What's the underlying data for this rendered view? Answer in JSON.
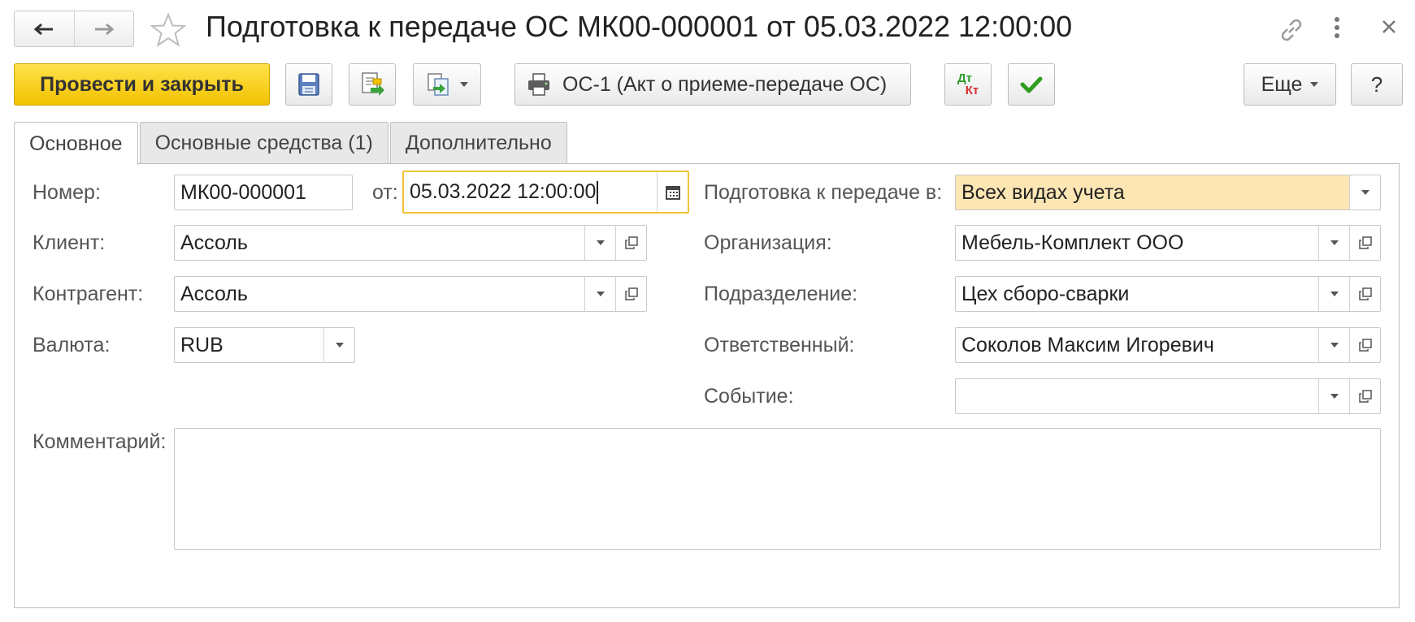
{
  "window": {
    "title": "Подготовка к передаче ОС МК00-000001 от 05.03.2022 12:00:00",
    "icons": {
      "back": "arrow-left-icon",
      "forward": "arrow-right-icon",
      "favorite": "star-icon",
      "link": "link-icon",
      "more": "kebab-menu-icon",
      "close": "close-icon"
    }
  },
  "toolbar": {
    "post_and_close": "Провести и закрыть",
    "print_label": "ОС-1 (Акт о приеме-передаче ОС)",
    "dt_label": "Дт",
    "kt_label": "Кт",
    "more_label": "Еще",
    "help_label": "?"
  },
  "tabs": [
    {
      "label": "Основное",
      "active": true
    },
    {
      "label": "Основные средства (1)",
      "active": false
    },
    {
      "label": "Дополнительно",
      "active": false
    }
  ],
  "form": {
    "number": {
      "label": "Номер:",
      "value": "МК00-000001"
    },
    "date": {
      "label": "от:",
      "value": "05.03.2022 12:00:00"
    },
    "client": {
      "label": "Клиент:",
      "value": "Ассоль"
    },
    "counterparty": {
      "label": "Контрагент:",
      "value": "Ассоль"
    },
    "currency": {
      "label": "Валюта:",
      "value": "RUB"
    },
    "prepare_in": {
      "label": "Подготовка к передаче в:",
      "value": "Всех видах учета"
    },
    "organization": {
      "label": "Организация:",
      "value": "Мебель-Комплект ООО"
    },
    "division": {
      "label": "Подразделение:",
      "value": "Цех сборо-сварки"
    },
    "responsible": {
      "label": "Ответственный:",
      "value": "Соколов Максим Игоревич"
    },
    "event": {
      "label": "Событие:",
      "value": ""
    },
    "comment": {
      "label": "Комментарий:",
      "value": ""
    }
  },
  "colors": {
    "primary_button": "#f5c800",
    "focus_border": "#f0c43a",
    "highlight_field": "#fce6b4",
    "check_green": "#2f9e1f",
    "dt_green": "#2c9a2c",
    "kt_red": "#d83030"
  }
}
